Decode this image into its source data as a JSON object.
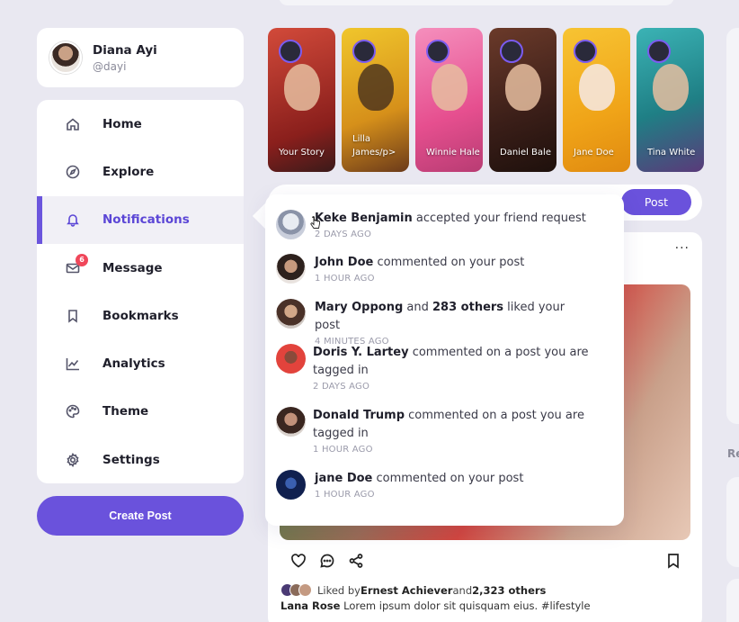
{
  "profile": {
    "name": "Diana Ayi",
    "handle": "@dayi"
  },
  "sidebar": {
    "items": [
      {
        "label": "Home",
        "icon": "home-icon"
      },
      {
        "label": "Explore",
        "icon": "compass-icon"
      },
      {
        "label": "Notifications",
        "icon": "bell-icon",
        "active": true
      },
      {
        "label": "Message",
        "icon": "mail-icon",
        "badge": "6"
      },
      {
        "label": "Bookmarks",
        "icon": "bookmark-icon"
      },
      {
        "label": "Analytics",
        "icon": "chart-line-icon"
      },
      {
        "label": "Theme",
        "icon": "palette-icon"
      },
      {
        "label": "Settings",
        "icon": "gear-icon"
      }
    ]
  },
  "create_post_label": "Create Post",
  "stories": [
    {
      "label": "Your Story",
      "bg": "#c8392f"
    },
    {
      "label": "Lilla James/p>",
      "bg": "#e3b11a"
    },
    {
      "label": "Winnie Hale",
      "bg": "#ef6fa8"
    },
    {
      "label": "Daniel Bale",
      "bg": "#4a2a22"
    },
    {
      "label": "Jane Doe",
      "bg": "#f2b320"
    },
    {
      "label": "Tina White",
      "bg": "#2a8f93"
    }
  ],
  "post_button_label": "Post",
  "notifications": [
    {
      "name": "Keke Benjamin",
      "text": " accepted your friend request",
      "time": "2 DAYS AGO",
      "avatar_color": "#c9cedb"
    },
    {
      "name": "John Doe",
      "text": " commented on your post",
      "time": "1 HOUR AGO",
      "avatar_color": "#4a3a34"
    },
    {
      "name": "Mary Oppong",
      "text_mid": " and ",
      "name2": "283 others",
      "text": " liked your post",
      "time": "4 MINUTES AGO",
      "avatar_color": "#6b4a3c"
    },
    {
      "name": "Doris Y. Lartey",
      "text": " commented on a post you are tagged in",
      "time": "2 DAYS AGO",
      "avatar_color": "#e2433c"
    },
    {
      "name": "Donald Trump",
      "text": " commented on a post you are tagged in",
      "time": "1 HOUR AGO",
      "avatar_color": "#5a3a30"
    },
    {
      "name": "jane Doe",
      "text": " commented on your post",
      "time": "1 HOUR AGO",
      "avatar_color": "#1a2f6b"
    }
  ],
  "feed": {
    "menu_glyph": "···",
    "liked_prefix": "Liked by ",
    "liked_name": "Ernest Achiever",
    "liked_mid": " and ",
    "liked_count": "2,323 others",
    "caption_user": "Lana Rose",
    "caption_text": " Lorem ipsum dolor sit quisquam eius. #lifestyle"
  },
  "right_label": "Re",
  "colors": {
    "accent": "#6a52dc",
    "badge": "#f0475a",
    "background": "#e9e8f1"
  }
}
